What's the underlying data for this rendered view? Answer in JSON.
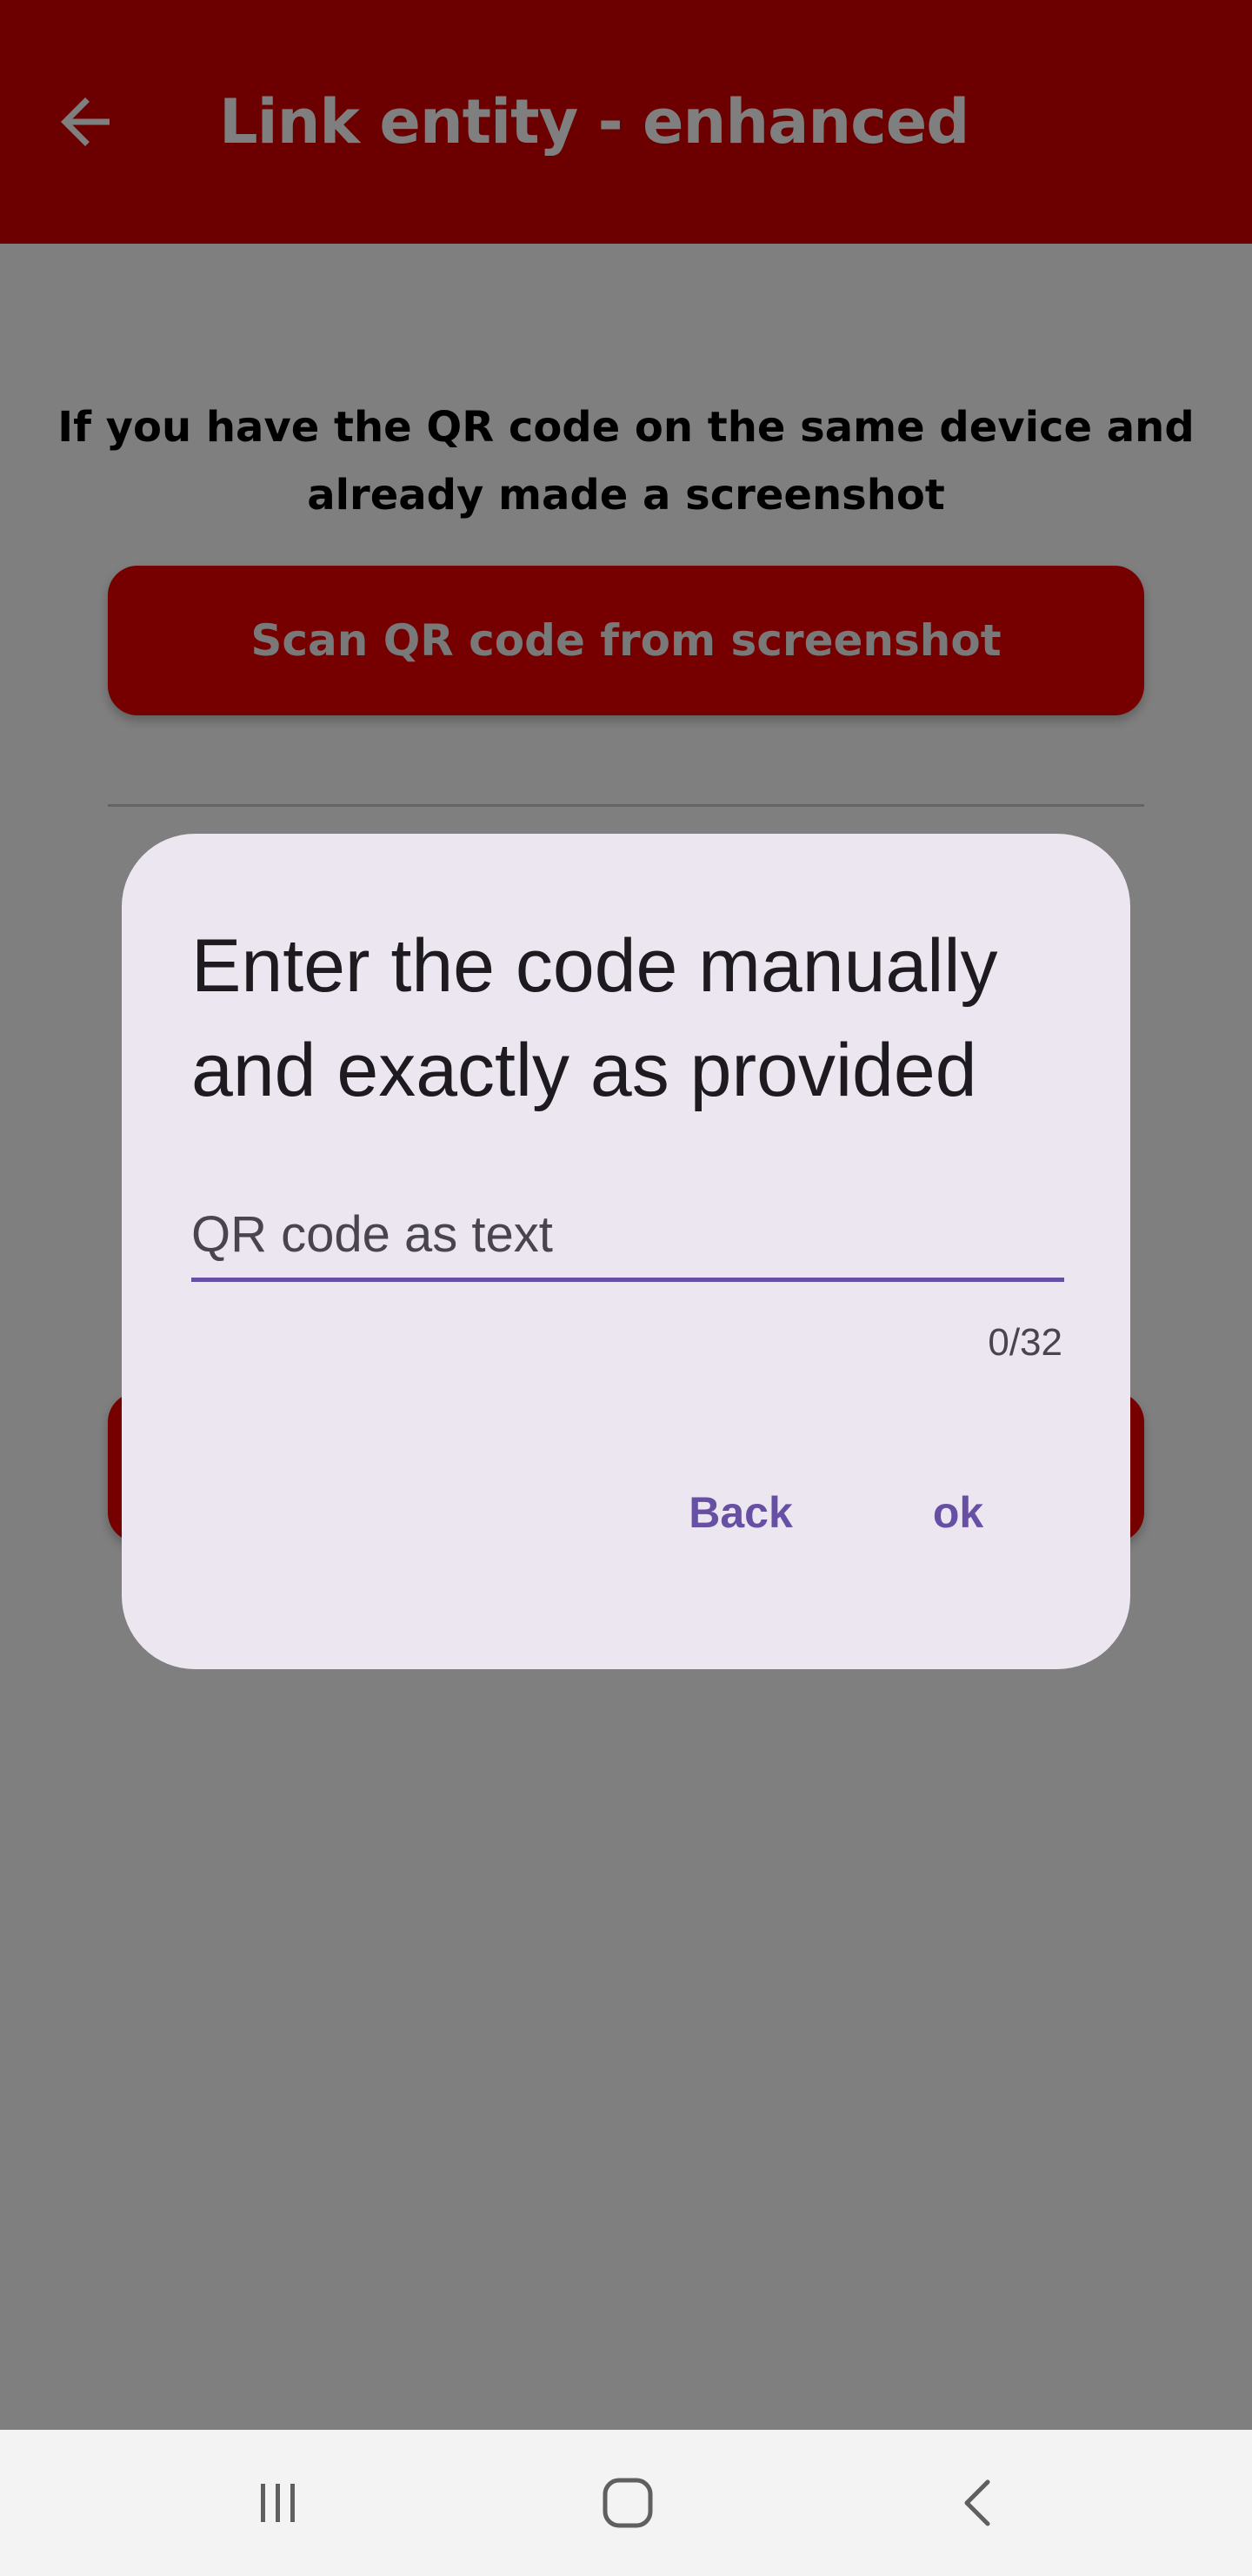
{
  "colors": {
    "app_bar": "#d80000",
    "button": "#ec0000",
    "dialog_background": "#ece6f0",
    "accent": "#6750a4"
  },
  "app_bar": {
    "title": "Link entity - enhanced",
    "back_icon": "arrow-left-icon"
  },
  "screen": {
    "instruction_screenshot": "If you have the QR code on the same device and already made a screenshot",
    "scan_button_label": "Scan QR code from screenshot",
    "instruction_second": "",
    "instruction_third": "",
    "manual_button_label": ""
  },
  "dialog": {
    "title": "Enter the code manually and exactly as provided",
    "input": {
      "value": "",
      "placeholder": "QR code as text"
    },
    "counter": "0/32",
    "back_label": "Back",
    "ok_label": "ok"
  },
  "nav_bar": {
    "recents_icon": "recent-apps-icon",
    "home_icon": "home-icon",
    "back_icon": "nav-back-icon"
  }
}
